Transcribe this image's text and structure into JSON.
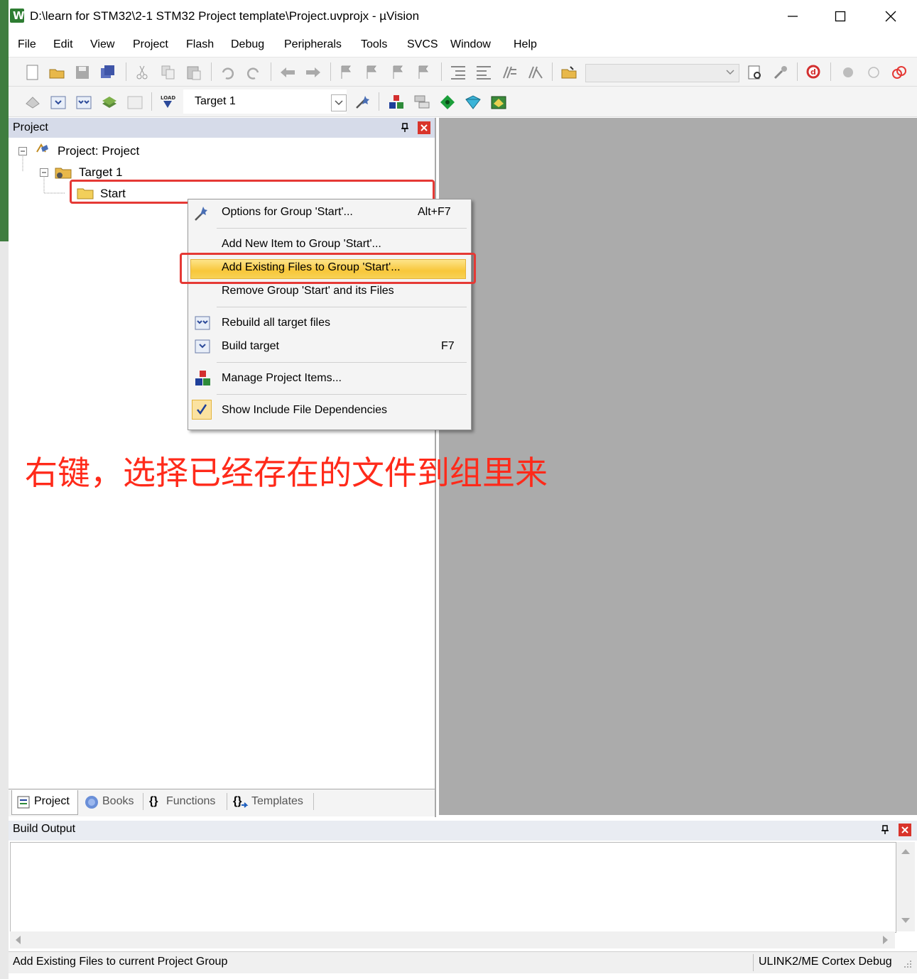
{
  "window": {
    "title": "D:\\learn for STM32\\2-1 STM32 Project template\\Project.uvprojx - µVision",
    "app_icon_letter": "W"
  },
  "menu": [
    "File",
    "Edit",
    "View",
    "Project",
    "Flash",
    "Debug",
    "Peripherals",
    "Tools",
    "SVCS",
    "Window",
    "Help"
  ],
  "toolbar2": {
    "target_select": "Target 1"
  },
  "project_panel": {
    "title": "Project",
    "tree": {
      "root": "Project: Project",
      "target": "Target 1",
      "group": "Start"
    }
  },
  "context_menu": {
    "items": [
      {
        "label": "Options for Group 'Start'...",
        "shortcut": "Alt+F7",
        "icon": "options-icon"
      },
      {
        "label": "Add New  Item to Group 'Start'...",
        "shortcut": ""
      },
      {
        "label": "Add Existing Files to Group 'Start'...",
        "shortcut": "",
        "highlighted": true
      },
      {
        "label": "Remove Group 'Start' and its Files",
        "shortcut": ""
      },
      {
        "label": "Rebuild all target files",
        "shortcut": "",
        "icon": "rebuild-icon"
      },
      {
        "label": "Build target",
        "shortcut": "F7",
        "icon": "build-icon"
      },
      {
        "label": "Manage Project Items...",
        "shortcut": "",
        "icon": "manage-items-icon"
      },
      {
        "label": "Show Include File Dependencies",
        "shortcut": "",
        "icon": "checkmark-icon",
        "checked": true
      }
    ]
  },
  "annotation": "右键，选择已经存在的文件到组里来",
  "bottom_tabs": [
    {
      "label": "Project",
      "active": true
    },
    {
      "label": "Books"
    },
    {
      "label": "Functions"
    },
    {
      "label": "Templates"
    }
  ],
  "build_output": {
    "title": "Build Output"
  },
  "status_bar": {
    "left": "Add Existing Files to current Project Group",
    "right": "ULINK2/ME Cortex Debug"
  },
  "colors": {
    "annotation_red": "#ff2a1a",
    "highlight_box": "#e53935",
    "menu_hover": "#f8c73a",
    "panel_header": "#d6dbe9"
  }
}
